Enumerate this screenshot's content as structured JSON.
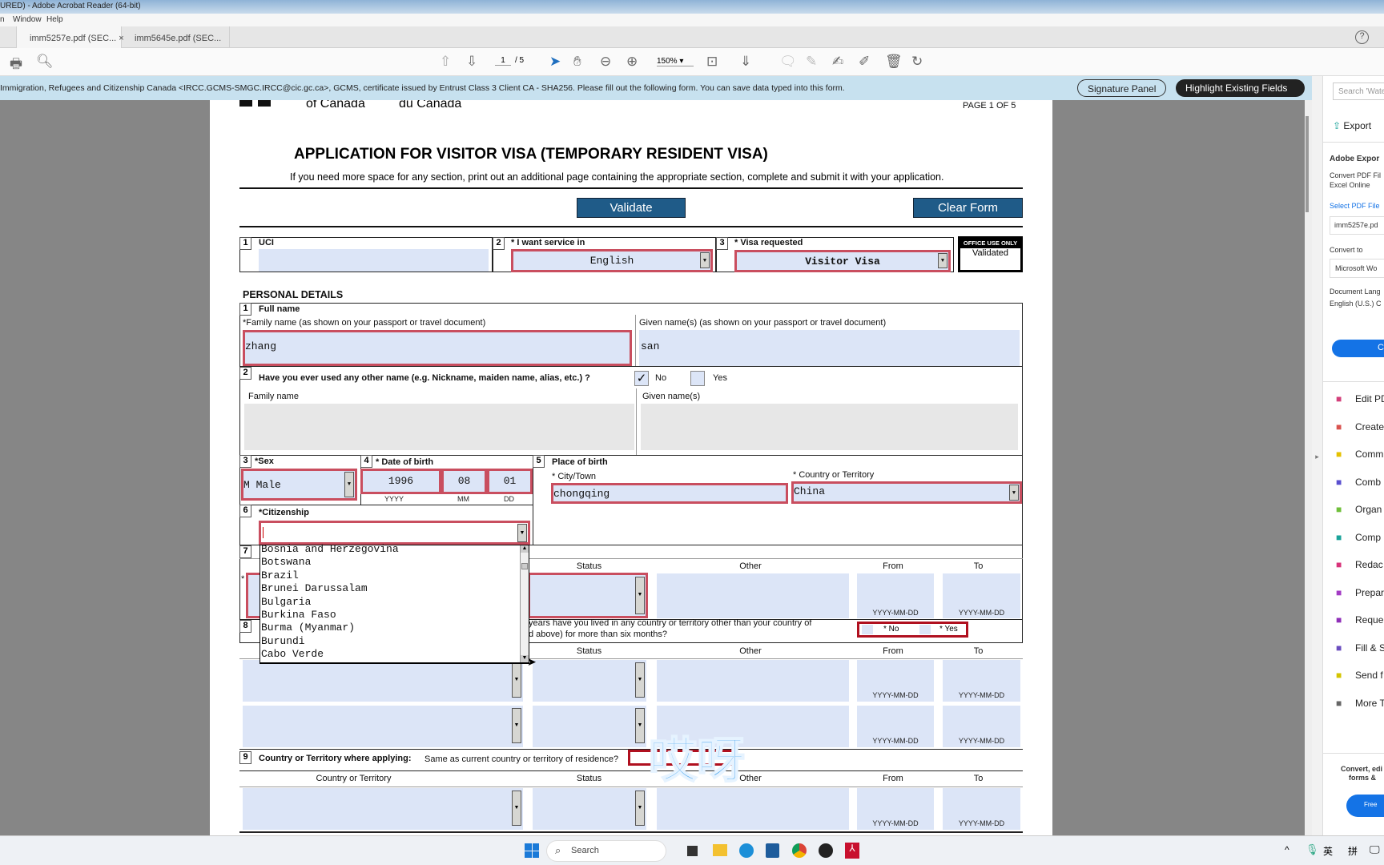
{
  "window": {
    "title": "URED) - Adobe Acrobat Reader (64-bit)",
    "menu": [
      "n",
      "Window",
      "Help"
    ]
  },
  "tabs": [
    {
      "label": "imm5257e.pdf (SEC...",
      "close": "×"
    },
    {
      "label": "imm5645e.pdf (SEC..."
    }
  ],
  "toolbar": {
    "page_current": "1",
    "page_total": "/ 5",
    "zoom": "150%",
    "help": "?"
  },
  "infobar": {
    "text": "Immigration, Refugees and Citizenship Canada <IRCC.GCMS-SMGC.IRCC@cic.gc.ca>, GCMS, certificate issued by Entrust Class 3 Client CA - SHA256.  Please fill out the following form. You can save data typed into this form.",
    "signature_panel": "Signature Panel",
    "highlight_fields": "Highlight Existing Fields"
  },
  "form": {
    "header_left": "of Canada",
    "header_mid": "du Canada",
    "page_label": "PAGE 1 OF 5",
    "title": "APPLICATION FOR VISITOR VISA (TEMPORARY RESIDENT VISA)",
    "subtitle": "If you need more space for any section, print out an additional page containing the appropriate section, complete and submit it with your application.",
    "validate": "Validate",
    "clear": "Clear Form",
    "uci": {
      "num": "1",
      "label": "UCI",
      "value": ""
    },
    "service": {
      "num": "2",
      "label": "* I want service in",
      "value": "English"
    },
    "visa": {
      "num": "3",
      "label": "* Visa requested",
      "value": "Visitor Visa"
    },
    "office": {
      "label": "OFFICE USE ONLY",
      "value": "Validated"
    },
    "section": "PERSONAL DETAILS",
    "q1": {
      "num": "1",
      "label": "Full name",
      "family_label": "*Family name  (as shown on your passport or travel document)",
      "family": "zhang",
      "given_label": "Given name(s)  (as shown on your passport or travel document)",
      "given": "san"
    },
    "q2": {
      "num": "2",
      "label": "Have you ever used any other name (e.g. Nickname, maiden name, alias, etc.) ?",
      "no": "No",
      "yes": "Yes",
      "no_checked": true,
      "family_label": "Family name",
      "given_label": "Given name(s)"
    },
    "q3": {
      "num": "3",
      "label": "*Sex",
      "value": "M Male"
    },
    "q4": {
      "num": "4",
      "label": "* Date of birth",
      "yyyy": "1996",
      "mm": "08",
      "dd": "01",
      "yyyy_l": "YYYY",
      "mm_l": "MM",
      "dd_l": "DD"
    },
    "q5": {
      "num": "5",
      "label": "Place of birth",
      "city_label": "* City/Town",
      "city": "chongqing",
      "country_label": "* Country or Territory",
      "country": "China"
    },
    "q6": {
      "num": "6",
      "label": "*Citizenship",
      "value": "",
      "options": [
        "Bosnia and Herzegovina",
        "Botswana",
        "Brazil",
        "Brunei Darussalam",
        "Bulgaria",
        "Burkina Faso",
        "Burma (Myanmar)",
        "Burundi",
        "Cabo Verde"
      ]
    },
    "q7": {
      "num": "7",
      "star": "*"
    },
    "q8": {
      "num": "8",
      "label1": "years have you lived in any country or territory other than your country of",
      "label2": "d above) for more than six months?",
      "no": "* No",
      "yes": "* Yes"
    },
    "q9": {
      "num": "9",
      "label": "Country or Territory where applying:",
      "question": "Same as current country or territory of residence?"
    },
    "cols": {
      "country": "Country or Territory",
      "status": "Status",
      "other": "Other",
      "from": "From",
      "to": "To",
      "date": "YYYY-MM-DD"
    }
  },
  "overlay_text": "哎呀",
  "right_panel": {
    "search": "Search 'Wate",
    "export": "Export",
    "adobe_export": "Adobe Expor",
    "convert_desc1": "Convert PDF Fil",
    "convert_desc2": "Excel Online",
    "select_label": "Select PDF File",
    "file": "imm5257e.pd",
    "convert_to": "Convert to",
    "format": "Microsoft Wo",
    "doc_lang": "Document Lang",
    "lang": "English (U.S.)  C",
    "convert_btn": "Co",
    "tools": [
      {
        "label": "Edit PD",
        "icon": "edit-pdf-icon",
        "color": "#d33f7a"
      },
      {
        "label": "Create",
        "icon": "create-pdf-icon",
        "color": "#d9534f"
      },
      {
        "label": "Comm",
        "icon": "comment-icon",
        "color": "#e5c100"
      },
      {
        "label": "Comb",
        "icon": "combine-icon",
        "color": "#5a4fcf"
      },
      {
        "label": "Organ",
        "icon": "organize-icon",
        "color": "#6fbf3a"
      },
      {
        "label": "Comp",
        "icon": "compress-icon",
        "color": "#1aa39a"
      },
      {
        "label": "Redac",
        "icon": "redact-icon",
        "color": "#d8337a"
      },
      {
        "label": "Prepar",
        "icon": "prepare-form-icon",
        "color": "#a33bc4"
      },
      {
        "label": "Reque",
        "icon": "request-sign-icon",
        "color": "#8f2fb8"
      },
      {
        "label": "Fill & S",
        "icon": "fill-sign-icon",
        "color": "#6a4cbf"
      },
      {
        "label": "Send f",
        "icon": "send-icon",
        "color": "#d4c400"
      },
      {
        "label": "More T",
        "icon": "more-tools-icon",
        "color": "#666"
      }
    ],
    "footer1": "Convert, edi",
    "footer2": "forms &",
    "free": "Free"
  },
  "taskbar": {
    "search": "Search",
    "tray": [
      "^",
      "英",
      "拼"
    ]
  }
}
